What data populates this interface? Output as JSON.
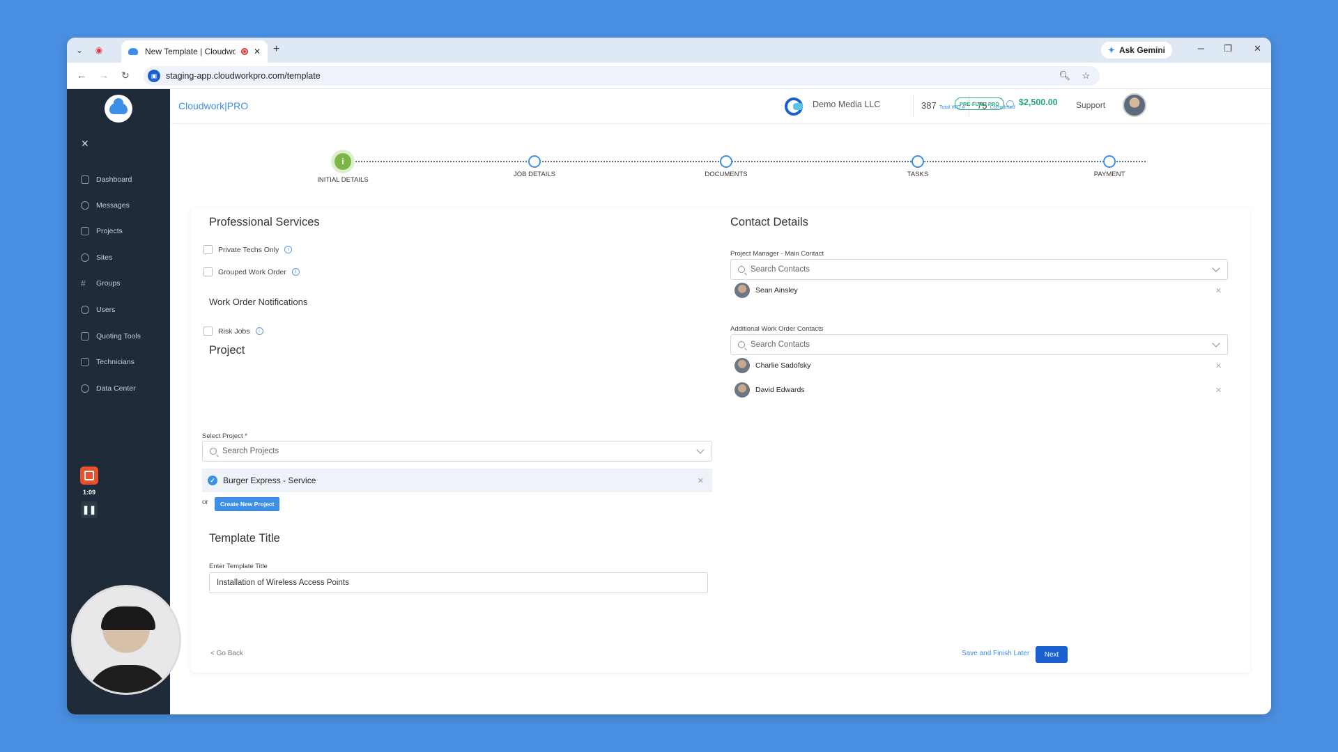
{
  "browser": {
    "tab_title": "New Template | Cloudwork",
    "ask_gemini": "Ask Gemini",
    "url": "staging-app.cloudworkpro.com/template"
  },
  "sidebar": {
    "items": [
      {
        "label": "Dashboard",
        "icon": "home-icon"
      },
      {
        "label": "Messages",
        "icon": "chat-icon"
      },
      {
        "label": "Projects",
        "icon": "folder-icon"
      },
      {
        "label": "Sites",
        "icon": "location-pin-icon"
      },
      {
        "label": "Groups",
        "icon": "hash-icon"
      },
      {
        "label": "Users",
        "icon": "users-icon"
      },
      {
        "label": "Quoting Tools",
        "icon": "calculator-icon"
      },
      {
        "label": "Technicians",
        "icon": "id-card-icon"
      },
      {
        "label": "Data Center",
        "icon": "database-icon"
      }
    ],
    "recording_time": "1:09"
  },
  "header": {
    "brand": "Cloudwork|PRO",
    "company": "Demo Media LLC",
    "total_wo_count": "387",
    "total_wo_label": "Total WO #",
    "completed_count": "75",
    "completed_label": "Completed",
    "prefund_badge": "PRE-FUND PRO",
    "balance": "$2,500.00",
    "support": "Support"
  },
  "stepper": {
    "steps": [
      "INITIAL DETAILS",
      "JOB DETAILS",
      "DOCUMENTS",
      "TASKS",
      "PAYMENT"
    ],
    "active_index": 0,
    "active_glyph": "i"
  },
  "professional_services": {
    "title": "Professional Services",
    "private_techs": "Private Techs Only",
    "grouped_work_order": "Grouped Work Order",
    "notifications_title": "Work Order Notifications",
    "risk_jobs": "Risk Jobs"
  },
  "project": {
    "title": "Project",
    "select_label": "Select Project *",
    "search_placeholder": "Search Projects",
    "selected": "Burger Express - Service",
    "or": "or",
    "create_button": "Create New Project"
  },
  "template": {
    "title": "Template Title",
    "input_label": "Enter Template Title",
    "value": "Installation of Wireless Access Points"
  },
  "contacts": {
    "title": "Contact Details",
    "pm_label": "Project Manager - Main Contact",
    "search_placeholder": "Search Contacts",
    "pm_contact": "Sean Ainsley",
    "additional_label": "Additional Work Order Contacts",
    "additional": [
      "Charlie Sadofsky",
      "David Edwards"
    ]
  },
  "footer": {
    "go_back": "< Go Back",
    "save_later": "Save and Finish Later",
    "next": "Next"
  },
  "colors": {
    "accent": "#3d8ee6",
    "sidebar_bg": "#1f2b38",
    "success": "#28a97a",
    "step_active": "#7ab648",
    "desktop_bg": "#4a90e2"
  }
}
